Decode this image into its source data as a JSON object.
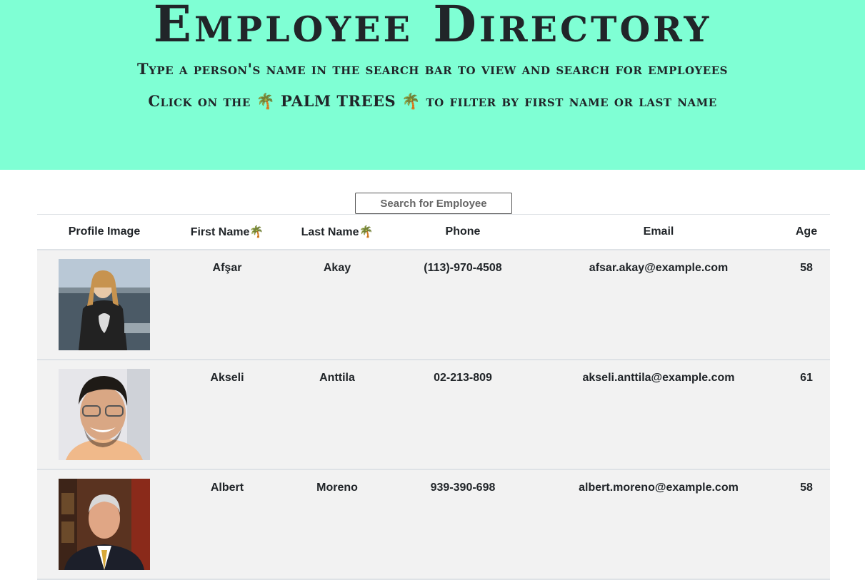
{
  "header": {
    "title": "Employee Directory",
    "instruction1": "Type a person's name in the search bar to view and search for employees",
    "instruction2_pre": "Click on the",
    "instruction2_mid": "PALM TREES",
    "instruction2_post": "to filter by first name or last name",
    "palm_glyph": "🌴"
  },
  "search": {
    "placeholder": "Search for Employee"
  },
  "table": {
    "columns": {
      "image": "Profile Image",
      "first": "First Name",
      "last": "Last Name",
      "phone": "Phone",
      "email": "Email",
      "age": "Age"
    },
    "rows": [
      {
        "first": "Afşar",
        "last": "Akay",
        "phone": "(113)-970-4508",
        "email": "afsar.akay@example.com",
        "age": "58"
      },
      {
        "first": "Akseli",
        "last": "Anttila",
        "phone": "02-213-809",
        "email": "akseli.anttila@example.com",
        "age": "61"
      },
      {
        "first": "Albert",
        "last": "Moreno",
        "phone": "939-390-698",
        "email": "albert.moreno@example.com",
        "age": "58"
      }
    ]
  },
  "colors": {
    "hero_bg": "#7fffd4",
    "row_bg": "#f2f2f2",
    "text": "#212529"
  }
}
